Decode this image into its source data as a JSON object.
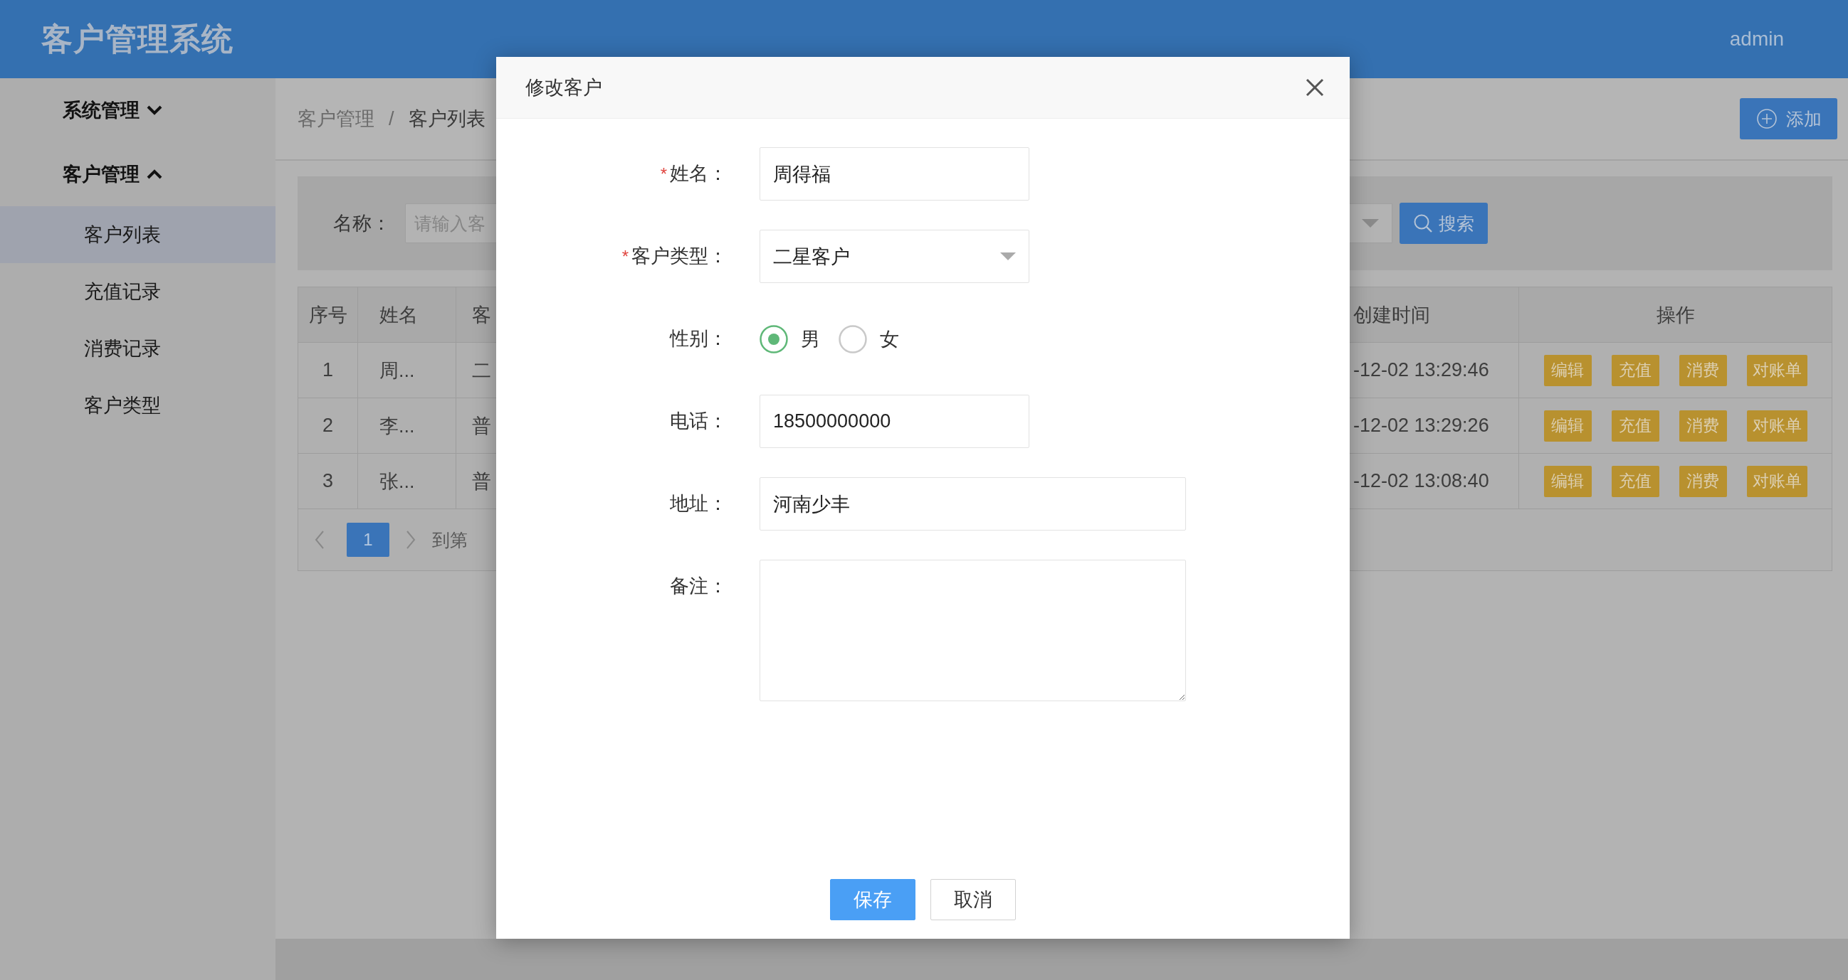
{
  "header": {
    "title": "客户管理系统",
    "user": "admin"
  },
  "sidebar": {
    "items": [
      {
        "label": "系统管理",
        "expanded": false
      },
      {
        "label": "客户管理",
        "expanded": true,
        "children": [
          {
            "label": "客户列表",
            "selected": true
          },
          {
            "label": "充值记录",
            "selected": false
          },
          {
            "label": "消费记录",
            "selected": false
          },
          {
            "label": "客户类型",
            "selected": false
          }
        ]
      }
    ]
  },
  "breadcrumb": {
    "items": [
      "客户管理",
      "客户列表"
    ],
    "separator": "/"
  },
  "add_button": "添加",
  "search": {
    "label": "名称：",
    "placeholder": "请输入客",
    "button": "搜索"
  },
  "table": {
    "columns": [
      "序号",
      "姓名",
      "客",
      "创建时间",
      "操作"
    ],
    "rows": [
      {
        "cells": [
          "1",
          "周...",
          "二",
          "-12-02 13:29:46"
        ],
        "actions": [
          "编辑",
          "充值",
          "消费",
          "对账单"
        ]
      },
      {
        "cells": [
          "2",
          "李...",
          "普",
          "-12-02 13:29:26"
        ],
        "actions": [
          "编辑",
          "充值",
          "消费",
          "对账单"
        ]
      },
      {
        "cells": [
          "3",
          "张...",
          "普",
          "-12-02 13:08:40"
        ],
        "actions": [
          "编辑",
          "充值",
          "消费",
          "对账单"
        ]
      }
    ]
  },
  "pagination": {
    "pages": [
      {
        "label": "1",
        "selected": true
      }
    ],
    "goto_label": "到第"
  },
  "dialog": {
    "title": "修改客户",
    "required_mark": "*",
    "fields": [
      {
        "kind": "text",
        "label": "姓名：",
        "required": true,
        "value": "周得福"
      },
      {
        "kind": "select",
        "label": "客户类型：",
        "required": true,
        "value": "二星客户"
      },
      {
        "kind": "radio",
        "label": "性别：",
        "required": false,
        "options": [
          {
            "label": "男",
            "selected": true
          },
          {
            "label": "女",
            "selected": false
          }
        ]
      },
      {
        "kind": "text",
        "label": "电话：",
        "required": false,
        "value": "18500000000"
      },
      {
        "kind": "long-text",
        "label": "地址：",
        "required": false,
        "value": "河南少丰"
      },
      {
        "kind": "textarea",
        "label": "备注：",
        "required": false
      }
    ],
    "buttons": [
      {
        "label": "保存",
        "primary": true
      },
      {
        "label": "取消",
        "primary": false
      }
    ]
  }
}
